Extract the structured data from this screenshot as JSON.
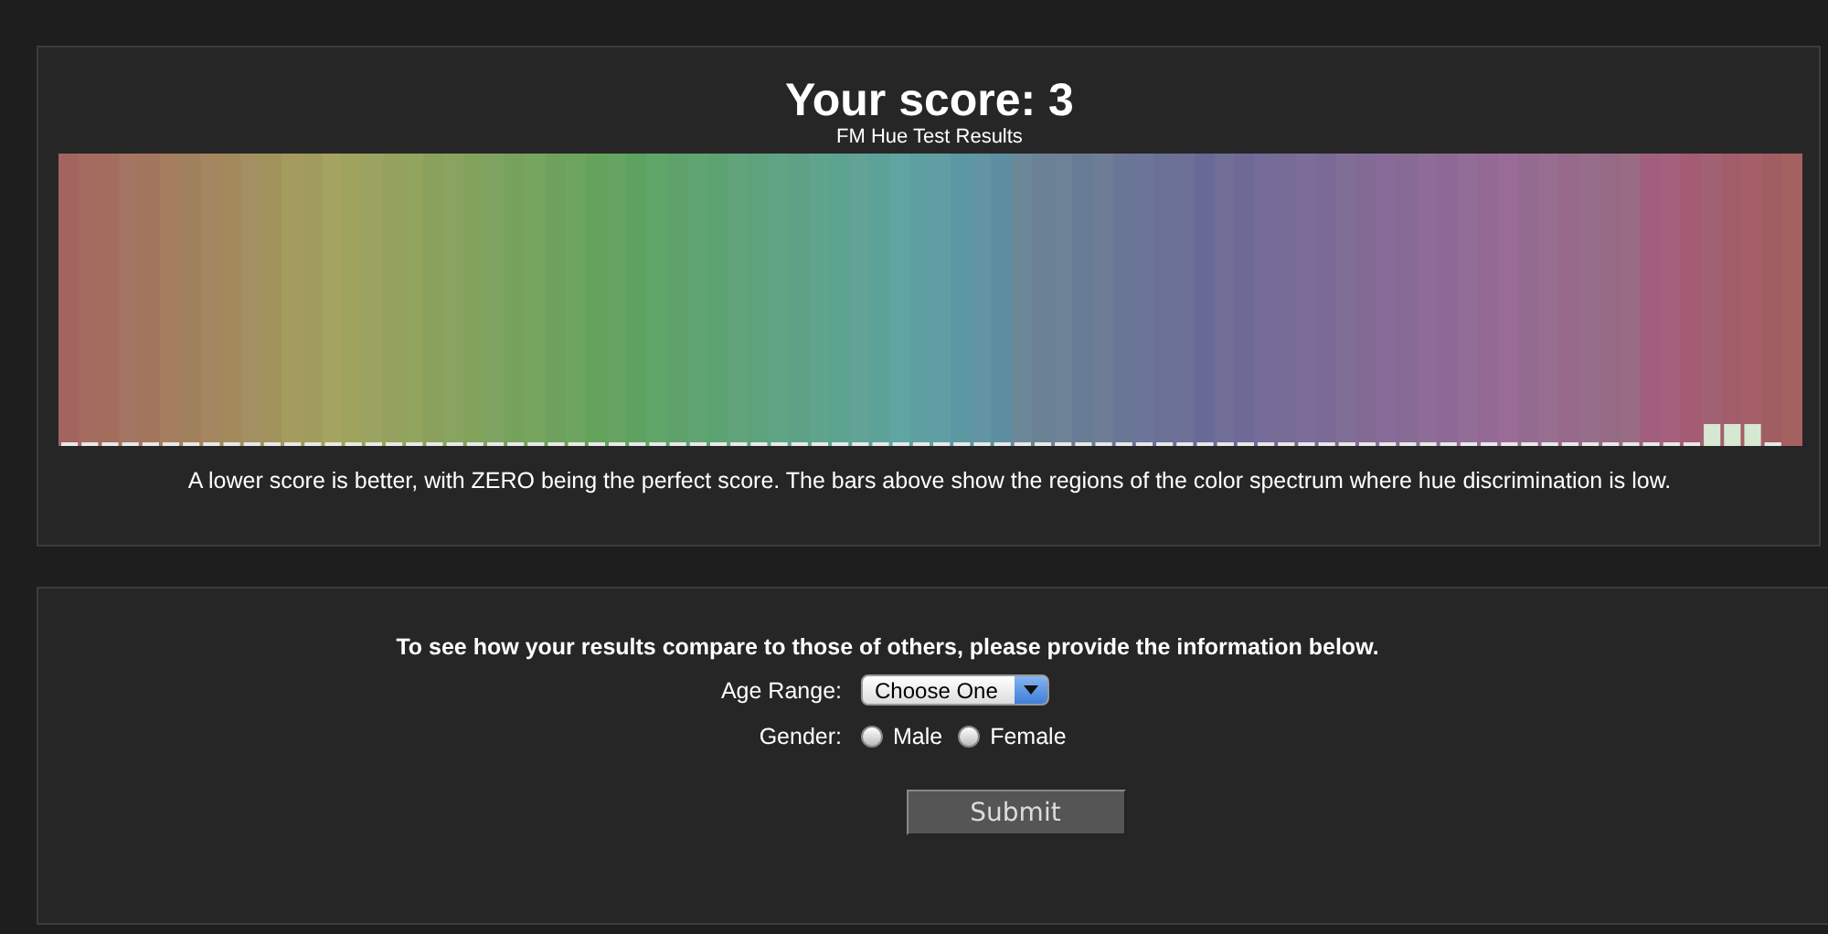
{
  "results": {
    "title": "Your score: 3",
    "subtitle": "FM Hue Test Results",
    "note": "A lower score is better, with ZERO being the perfect score. The bars above show the regions of the color spectrum where hue discrimination is low."
  },
  "form": {
    "intro": "To see how your results compare to those of others, please provide the information below.",
    "age_label": "Age Range:",
    "age_value": "Choose One",
    "gender_label": "Gender:",
    "gender_options": [
      {
        "label": "Male",
        "selected": false
      },
      {
        "label": "Female",
        "selected": false
      }
    ],
    "submit": "Submit"
  }
}
